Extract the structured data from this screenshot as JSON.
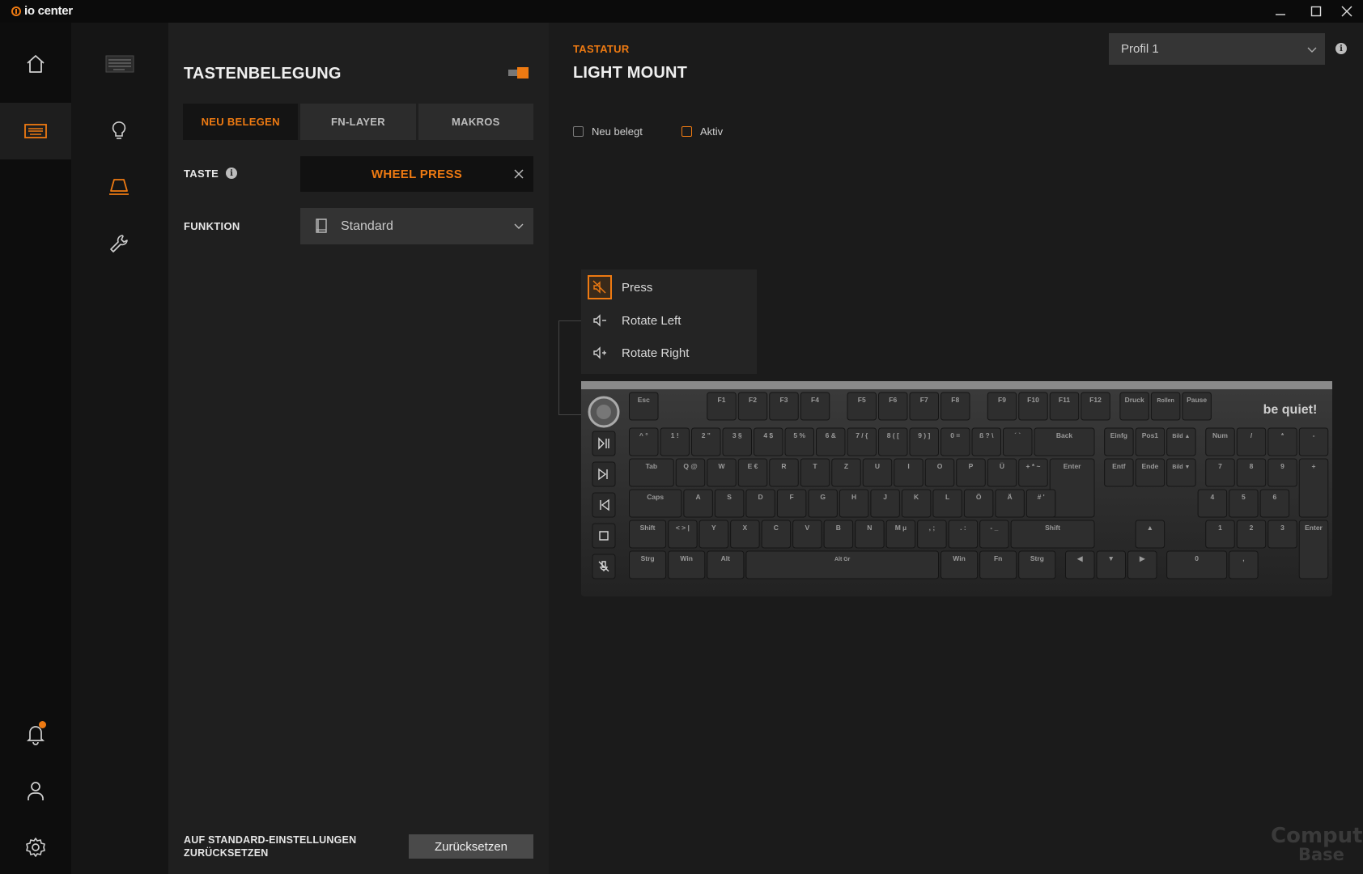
{
  "app": {
    "title": "io center",
    "logo_icon": "be-quiet-power-icon"
  },
  "window_controls": [
    "minimize-icon",
    "maximize-icon",
    "close-icon"
  ],
  "nav_primary": [
    {
      "id": "home",
      "icon": "home-icon"
    },
    {
      "id": "keyboard",
      "icon": "keyboard-icon",
      "active": true
    },
    {
      "id": "notifications",
      "icon": "bell-icon",
      "has_badge": true
    },
    {
      "id": "account",
      "icon": "user-icon"
    },
    {
      "id": "settings",
      "icon": "gear-icon"
    }
  ],
  "nav_secondary": [
    {
      "id": "device",
      "icon": "keyboard-thumbnail"
    },
    {
      "id": "lighting",
      "icon": "lightbulb-icon"
    },
    {
      "id": "key-assignment",
      "icon": "keycap-icon",
      "active": true
    },
    {
      "id": "tools",
      "icon": "wrench-icon"
    }
  ],
  "panel": {
    "title": "TASTENBELEGUNG",
    "tabs": [
      {
        "label": "NEU BELEGEN",
        "active": true
      },
      {
        "label": "FN-LAYER",
        "active": false
      },
      {
        "label": "MAKROS",
        "active": false
      }
    ],
    "key_label": "TASTE",
    "key_value": "WHEEL PRESS",
    "function_label": "FUNKTION",
    "function_value": "Standard",
    "reset_label_line1": "AUF STANDARD-EINSTELLUNGEN",
    "reset_label_line2": "ZURÜCKSETZEN",
    "reset_button": "Zurücksetzen"
  },
  "main": {
    "subtitle": "TASTATUR",
    "title": "LIGHT MOUNT",
    "profile": "Profil 1",
    "legend": [
      {
        "label": "Neu belegt",
        "color": "#7a7a7a"
      },
      {
        "label": "Aktiv",
        "color": "#ee7a12"
      }
    ],
    "wheel_menu": [
      {
        "label": "Press",
        "icon": "mute-icon",
        "selected": true
      },
      {
        "label": "Rotate Left",
        "icon": "volume-down-icon",
        "selected": false
      },
      {
        "label": "Rotate Right",
        "icon": "volume-up-icon",
        "selected": false
      }
    ],
    "watermark_line1": "Computer",
    "watermark_line2": "Base"
  },
  "keyboard": {
    "brand": "be quiet!",
    "media_keys": [
      "play-pause-icon",
      "next-track-icon",
      "previous-track-icon",
      "stop-icon",
      "mic-mute-icon"
    ],
    "rows": [
      [
        "Esc",
        "F1",
        "F2",
        "F3",
        "F4",
        "F5",
        "F6",
        "F7",
        "F8",
        "F9",
        "F10",
        "F11",
        "F12",
        "Druck",
        "Rollen",
        "Pause"
      ],
      [
        "^ °",
        "1 !",
        "2 \"",
        "3 §",
        "4 $",
        "5 %",
        "6 &",
        "7 / {",
        "8 ( [",
        "9 ) ]",
        "0 =",
        "ß ? \\",
        "´ `",
        "Back",
        "Einfg",
        "Pos1",
        "Bild ▲",
        "Num",
        "/",
        "*",
        "-"
      ],
      [
        "Tab",
        "Q @",
        "W",
        "E €",
        "R",
        "T",
        "Z",
        "U",
        "I",
        "O",
        "P",
        "Ü",
        "+ * ~",
        "Enter",
        "Entf",
        "Ende",
        "Bild ▼",
        "7",
        "8",
        "9",
        "+"
      ],
      [
        "Caps",
        "A",
        "S",
        "D",
        "F",
        "G",
        "H",
        "J",
        "K",
        "L",
        "Ö",
        "Ä",
        "# '",
        "4",
        "5",
        "6"
      ],
      [
        "Shift",
        "< > |",
        "Y",
        "X",
        "C",
        "V",
        "B",
        "N",
        "M µ",
        ", ;",
        ". :",
        "- _",
        "Shift",
        "▲",
        "1",
        "2",
        "3",
        "Enter"
      ],
      [
        "Strg",
        "Win",
        "Alt",
        "Alt Gr",
        "Win",
        "Fn",
        "Strg",
        "◀",
        "▼",
        "▶",
        "0",
        ","
      ]
    ]
  }
}
